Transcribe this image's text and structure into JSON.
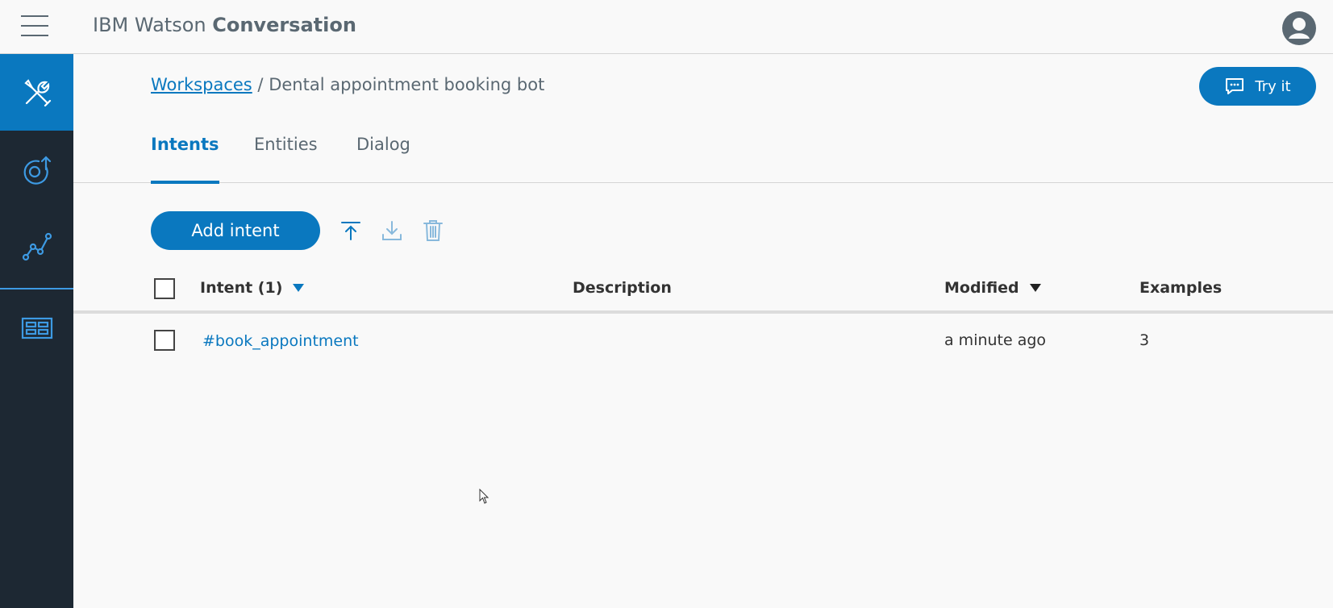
{
  "header": {
    "brand_prefix": "IBM Watson",
    "brand_name": "Conversation"
  },
  "rail": {
    "items": [
      {
        "name": "build-tools",
        "icon": "tools-icon",
        "active": true
      },
      {
        "name": "deploy",
        "icon": "deploy-icon",
        "active": false
      },
      {
        "name": "improve",
        "icon": "analytics-icon",
        "active": false
      },
      {
        "name": "dashboard",
        "icon": "dashboard-icon",
        "active": false
      }
    ]
  },
  "breadcrumb": {
    "link": "Workspaces",
    "separator": "/",
    "current": "Dental appointment booking bot"
  },
  "try_button": {
    "label": "Try it"
  },
  "tabs": [
    {
      "label": "Intents",
      "active": true
    },
    {
      "label": "Entities",
      "active": false
    },
    {
      "label": "Dialog",
      "active": false
    }
  ],
  "toolbar": {
    "add_label": "Add intent",
    "icons": [
      "upload-icon",
      "download-icon",
      "trash-icon"
    ]
  },
  "table": {
    "columns": {
      "intent": "Intent (1)",
      "description": "Description",
      "modified": "Modified",
      "examples": "Examples"
    },
    "rows": [
      {
        "intent": "#book_appointment",
        "description": "",
        "modified": "a minute ago",
        "examples": "3"
      }
    ]
  },
  "colors": {
    "accent": "#0a78bf",
    "rail_bg": "#1d2833",
    "page_bg": "#f9f9f9"
  }
}
